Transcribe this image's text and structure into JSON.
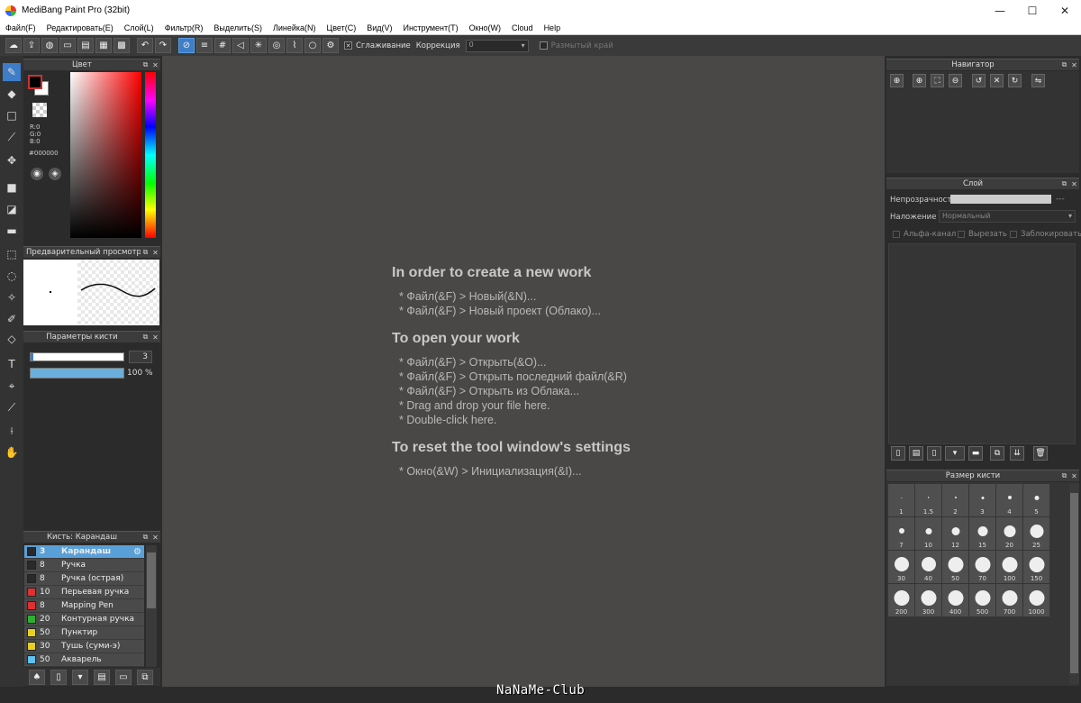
{
  "window": {
    "title": "MediBang Paint Pro (32bit)",
    "controls": [
      "—",
      "☐",
      "✕"
    ]
  },
  "menu": [
    "Файл(F)",
    "Редактировать(E)",
    "Слой(L)",
    "Фильтр(R)",
    "Выделить(S)",
    "Линейка(N)",
    "Цвет(C)",
    "Вид(V)",
    "Инструмент(T)",
    "Окно(W)",
    "Cloud",
    "Help"
  ],
  "toolbar": {
    "smoothing_label": "Сглаживание",
    "smoothing_checked": true,
    "correction_label": "Коррекция",
    "correction_value": "0",
    "blur_edge_label": "Размытый край",
    "blur_edge_checked": false
  },
  "color_panel": {
    "title": "Цвет",
    "rgb_r": "R:0",
    "rgb_g": "G:0",
    "rgb_b": "B:0",
    "hex": "#000000",
    "fg_color": "#000000",
    "bg_color": "#ffffff"
  },
  "preview_panel": {
    "title": "Предварительный просмотр к..."
  },
  "brush_params": {
    "title": "Параметры кисти",
    "size": "3",
    "opacity": "100 %"
  },
  "brush_list": {
    "title": "Кисть: Карандаш",
    "items": [
      {
        "size": "3",
        "name": "Карандаш",
        "color": "#2a2a2a",
        "selected": true
      },
      {
        "size": "8",
        "name": "Ручка",
        "color": "#2a2a2a"
      },
      {
        "size": "8",
        "name": "Ручка (острая)",
        "color": "#2a2a2a"
      },
      {
        "size": "10",
        "name": "Перьевая ручка",
        "color": "#e03030"
      },
      {
        "size": "8",
        "name": "Mapping Pen",
        "color": "#e03030"
      },
      {
        "size": "20",
        "name": "Контурная ручка",
        "color": "#30b030"
      },
      {
        "size": "50",
        "name": "Пунктир",
        "color": "#e8d020"
      },
      {
        "size": "30",
        "name": "Тушь (суми-э)",
        "color": "#e8d020"
      },
      {
        "size": "50",
        "name": "Акварель",
        "color": "#60c0f0"
      }
    ]
  },
  "canvas_guide": {
    "new_title": "In order to create a new work",
    "new_lines": [
      "* Файл(&F) > Новый(&N)...",
      "* Файл(&F) > Новый проект (Облако)..."
    ],
    "open_title": "To open your work",
    "open_lines": [
      "* Файл(&F) > Открыть(&O)...",
      "* Файл(&F) > Открыть последний файл(&R)",
      "* Файл(&F) > Открыть из Облака...",
      "* Drag and drop your file here.",
      "* Double-click here."
    ],
    "reset_title": "To reset the tool window's settings",
    "reset_lines": [
      "* Окно(&W) > Инициализация(&I)..."
    ]
  },
  "navigator": {
    "title": "Навигатор"
  },
  "layer_panel": {
    "title": "Слой",
    "opacity_label": "Непрозрачность",
    "opacity_value": "---",
    "blend_label": "Наложение",
    "blend_value": "Нормальный",
    "alpha_label": "Альфа-канал",
    "clip_label": "Вырезать",
    "lock_label": "Заблокировать"
  },
  "brush_size_panel": {
    "title": "Размер кисти",
    "sizes": [
      "1",
      "1.5",
      "2",
      "3",
      "4",
      "5",
      "7",
      "10",
      "12",
      "15",
      "20",
      "25",
      "30",
      "40",
      "50",
      "70",
      "100",
      "150",
      "200",
      "300",
      "400",
      "500",
      "700",
      "1000"
    ]
  },
  "watermark": "NaNaMe-Club"
}
